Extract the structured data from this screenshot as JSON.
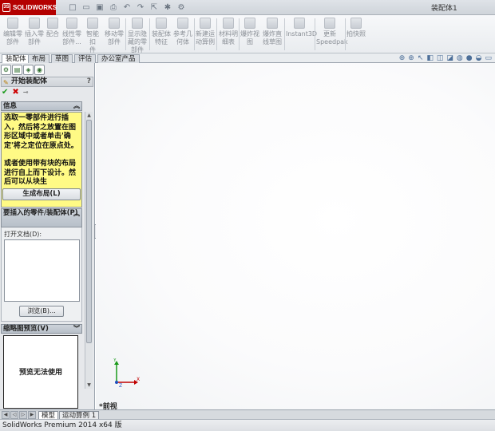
{
  "app": {
    "brand": "SOLIDWORKS",
    "document_title": "装配体1",
    "quick_access_icons": [
      "new-icon",
      "open-icon",
      "save-icon",
      "print-icon",
      "undo-icon",
      "redo-icon",
      "select-icon",
      "rebuild-icon",
      "options-icon"
    ]
  },
  "toolbar": {
    "buttons": [
      {
        "label1": "编辑零",
        "label2": "部件",
        "icon": "edit-component-icon"
      },
      {
        "label1": "插入零",
        "label2": "部件",
        "icon": "insert-component-icon"
      },
      {
        "label1": "配合",
        "label2": "",
        "icon": "mate-icon"
      },
      {
        "label1": "线性零",
        "label2": "部件...",
        "icon": "linear-pattern-icon"
      },
      {
        "label1": "智能扣",
        "label2": "件",
        "icon": "smart-fastener-icon"
      },
      {
        "label1": "移动零",
        "label2": "部件",
        "icon": "move-component-icon"
      },
      {
        "label1": "显示隐",
        "label2": "藏的零",
        "label3": "部件",
        "icon": "show-hidden-icon"
      },
      {
        "label1": "装配体",
        "label2": "特征",
        "icon": "assembly-feature-icon"
      },
      {
        "label1": "参考几",
        "label2": "何体",
        "icon": "reference-geometry-icon"
      },
      {
        "label1": "新建运",
        "label2": "动算例",
        "icon": "new-motion-study-icon"
      },
      {
        "label1": "材料明",
        "label2": "细表",
        "icon": "bom-icon"
      },
      {
        "label1": "爆炸视",
        "label2": "图",
        "icon": "exploded-view-icon"
      },
      {
        "label1": "爆炸直",
        "label2": "线草图",
        "icon": "explode-line-sketch-icon"
      },
      {
        "label1": "Instant3D",
        "label2": "",
        "icon": "instant3d-icon"
      },
      {
        "label1": "更新",
        "label2": "Speedpak",
        "icon": "update-speedpak-icon"
      },
      {
        "label1": "拍快照",
        "label2": "",
        "icon": "snapshot-icon"
      }
    ]
  },
  "tabs": [
    "装配体",
    "布局",
    "草图",
    "评估",
    "办公室产品"
  ],
  "active_tab": "装配体",
  "view_tools": [
    "zoom-fit-icon",
    "zoom-area-icon",
    "previous-view-icon",
    "section-view-icon",
    "view-orientation-icon",
    "display-style-icon",
    "hide-show-icon",
    "edit-appearance-icon",
    "apply-scene-icon",
    "view-settings-icon"
  ],
  "property_manager": {
    "tab_icons": [
      "feature-manager-icon",
      "property-manager-icon",
      "configuration-manager-icon",
      "display-manager-icon"
    ],
    "title": "开始装配体",
    "help": "?",
    "info_header": "信息",
    "info_para1": "选取一零部件进行插入，然后将之放置在图形区域中或者单击'确定'将之定位在原点处。",
    "info_para2": "或者使用带有块的布局进行自上而下设计。然后可以从块生",
    "layout_button": "生成布局(L)",
    "insert_header": "要插入的零件/装配体(P)",
    "open_docs_label": "打开文档(D):",
    "browse_button": "浏览(B)...",
    "thumbnail_header": "缩略图预览(V)",
    "thumbnail_text": "预览无法使用"
  },
  "canvas": {
    "view_label": "*前视",
    "triad": {
      "x": "X",
      "y": "Y",
      "z": "Z"
    }
  },
  "bottom_tabs": [
    "模型",
    "运动算例 1"
  ],
  "active_bottom_tab": "模型",
  "status": "SolidWorks Premium 2014 x64 版",
  "colors": {
    "brand_red": "#b40000",
    "info_yellow": "#fffa85",
    "x_axis": "#c00000",
    "y_axis": "#1a9a1a",
    "z_axis": "#1f4fbf"
  }
}
